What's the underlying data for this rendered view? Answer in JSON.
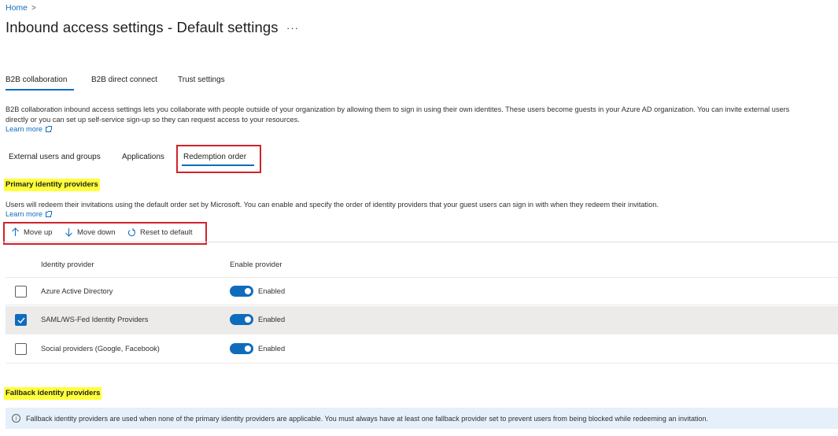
{
  "breadcrumb": {
    "home": "Home",
    "separator": ">"
  },
  "page": {
    "title": "Inbound access settings - Default settings",
    "more": "···"
  },
  "main_tabs": [
    {
      "label": "B2B collaboration",
      "selected": true
    },
    {
      "label": "B2B direct connect",
      "selected": false
    },
    {
      "label": "Trust settings",
      "selected": false
    }
  ],
  "description": {
    "line1": "B2B collaboration inbound access settings lets you collaborate with people outside of your organization by allowing them to sign in using their own identites. These users become guests in your Azure AD organization. You can invite external users",
    "line2": "directly or you can set up self-service sign-up so they can request access to your resources.",
    "learn_more": "Learn more"
  },
  "sub_tabs": [
    {
      "label": "External users and groups",
      "selected": false
    },
    {
      "label": "Applications",
      "selected": false
    },
    {
      "label": "Redemption order",
      "selected": true
    }
  ],
  "primary": {
    "heading": "Primary identity providers",
    "description": "Users will redeem their invitations using the default order set by Microsoft. You can enable and specify the order of identity providers that your guest users can sign in with when they redeem their invitation.",
    "learn_more": "Learn more"
  },
  "toolbar": {
    "move_up": "Move up",
    "move_down": "Move down",
    "reset": "Reset to default",
    "icons": [
      "arrow-up-icon",
      "arrow-down-icon",
      "reset-icon"
    ]
  },
  "table": {
    "headers": {
      "provider": "Identity provider",
      "enable": "Enable provider"
    },
    "rows": [
      {
        "name": "Azure Active Directory",
        "enabled_label": "Enabled",
        "checked": false,
        "enabled": true
      },
      {
        "name": "SAML/WS-Fed Identity Providers",
        "enabled_label": "Enabled",
        "checked": true,
        "enabled": true
      },
      {
        "name": "Social providers (Google, Facebook)",
        "enabled_label": "Enabled",
        "checked": false,
        "enabled": true
      }
    ]
  },
  "fallback": {
    "heading": "Fallback identity providers",
    "info_icon": "i",
    "info": "Fallback identity providers are used when none of the primary identity providers are applicable. You must always have at least one fallback provider set to prevent users from being blocked while redeeming an invitation."
  },
  "colors": {
    "accent": "#0f6cbd",
    "highlight": "#ffff3b",
    "annotation_box": "#d1222b",
    "selected_row": "#edebe9",
    "info_bg": "#e5f0fb"
  }
}
